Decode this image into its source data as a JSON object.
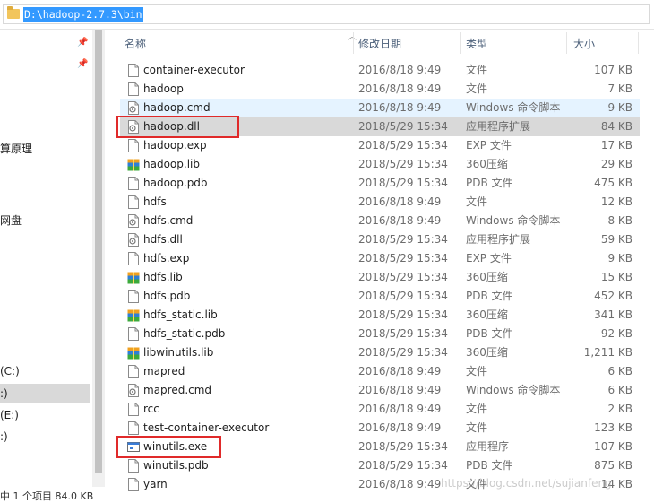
{
  "address_bar": {
    "path": "D:\\hadoop-2.7.3\\bin"
  },
  "nav": {
    "items": [
      {
        "label": "算原理"
      },
      {
        "label": "网盘"
      },
      {
        "label": "(C:)"
      },
      {
        "label": ":)"
      },
      {
        "label": "(E:)"
      },
      {
        "label": ":)"
      }
    ]
  },
  "status": {
    "text": "中 1 个项目  84.0 KB"
  },
  "columns": {
    "name": "名称",
    "date": "修改日期",
    "type": "类型",
    "size": "大小"
  },
  "files": [
    {
      "name": "container-executor",
      "date": "2016/8/18 9:49",
      "type": "文件",
      "size": "107 KB",
      "icon": "blank-file-icon"
    },
    {
      "name": "hadoop",
      "date": "2016/8/18 9:49",
      "type": "文件",
      "size": "7 KB",
      "icon": "blank-file-icon"
    },
    {
      "name": "hadoop.cmd",
      "date": "2016/8/18 9:49",
      "type": "Windows 命令脚本",
      "size": "9 KB",
      "icon": "cmd-script-icon"
    },
    {
      "name": "hadoop.dll",
      "date": "2018/5/29 15:34",
      "type": "应用程序扩展",
      "size": "84 KB",
      "icon": "dll-gear-icon"
    },
    {
      "name": "hadoop.exp",
      "date": "2018/5/29 15:34",
      "type": "EXP 文件",
      "size": "17 KB",
      "icon": "blank-file-icon"
    },
    {
      "name": "hadoop.lib",
      "date": "2018/5/29 15:34",
      "type": "360压缩",
      "size": "29 KB",
      "icon": "archive-360-icon"
    },
    {
      "name": "hadoop.pdb",
      "date": "2018/5/29 15:34",
      "type": "PDB 文件",
      "size": "475 KB",
      "icon": "blank-file-icon"
    },
    {
      "name": "hdfs",
      "date": "2016/8/18 9:49",
      "type": "文件",
      "size": "12 KB",
      "icon": "blank-file-icon"
    },
    {
      "name": "hdfs.cmd",
      "date": "2016/8/18 9:49",
      "type": "Windows 命令脚本",
      "size": "8 KB",
      "icon": "cmd-script-icon"
    },
    {
      "name": "hdfs.dll",
      "date": "2018/5/29 15:34",
      "type": "应用程序扩展",
      "size": "59 KB",
      "icon": "dll-gear-icon"
    },
    {
      "name": "hdfs.exp",
      "date": "2018/5/29 15:34",
      "type": "EXP 文件",
      "size": "9 KB",
      "icon": "blank-file-icon"
    },
    {
      "name": "hdfs.lib",
      "date": "2018/5/29 15:34",
      "type": "360压缩",
      "size": "15 KB",
      "icon": "archive-360-icon"
    },
    {
      "name": "hdfs.pdb",
      "date": "2018/5/29 15:34",
      "type": "PDB 文件",
      "size": "452 KB",
      "icon": "blank-file-icon"
    },
    {
      "name": "hdfs_static.lib",
      "date": "2018/5/29 15:34",
      "type": "360压缩",
      "size": "341 KB",
      "icon": "archive-360-icon"
    },
    {
      "name": "hdfs_static.pdb",
      "date": "2018/5/29 15:34",
      "type": "PDB 文件",
      "size": "92 KB",
      "icon": "blank-file-icon"
    },
    {
      "name": "libwinutils.lib",
      "date": "2018/5/29 15:34",
      "type": "360压缩",
      "size": "1,211 KB",
      "icon": "archive-360-icon"
    },
    {
      "name": "mapred",
      "date": "2016/8/18 9:49",
      "type": "文件",
      "size": "6 KB",
      "icon": "blank-file-icon"
    },
    {
      "name": "mapred.cmd",
      "date": "2016/8/18 9:49",
      "type": "Windows 命令脚本",
      "size": "6 KB",
      "icon": "cmd-script-icon"
    },
    {
      "name": "rcc",
      "date": "2016/8/18 9:49",
      "type": "文件",
      "size": "2 KB",
      "icon": "blank-file-icon"
    },
    {
      "name": "test-container-executor",
      "date": "2016/8/18 9:49",
      "type": "文件",
      "size": "123 KB",
      "icon": "blank-file-icon"
    },
    {
      "name": "winutils.exe",
      "date": "2018/5/29 15:34",
      "type": "应用程序",
      "size": "107 KB",
      "icon": "exe-window-icon"
    },
    {
      "name": "winutils.pdb",
      "date": "2018/5/29 15:34",
      "type": "PDB 文件",
      "size": "875 KB",
      "icon": "blank-file-icon"
    },
    {
      "name": "yarn",
      "date": "2016/8/18 9:49",
      "type": "文件",
      "size": "14 KB",
      "icon": "blank-file-icon"
    }
  ],
  "watermark": "https://blog.csdn.net/sujianfeng",
  "colors": {
    "selection": "#3399ff",
    "hover_row": "#e5f3ff",
    "selected_row": "#d9d9d9",
    "annotation_red": "#e02a2a"
  }
}
